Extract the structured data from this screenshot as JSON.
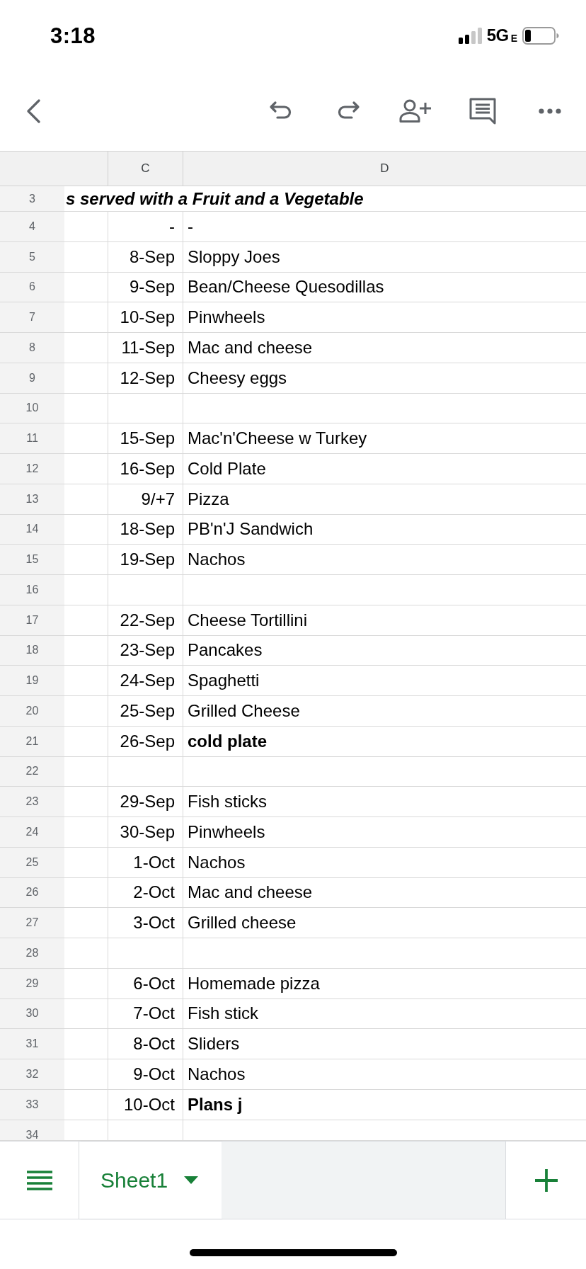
{
  "status_bar": {
    "time": "3:18",
    "network": "5G",
    "network_suffix": "E"
  },
  "sheet": {
    "columns": [
      {
        "label": "C"
      },
      {
        "label": "D"
      }
    ],
    "rows": [
      {
        "number": "3",
        "kind": "title",
        "text": "s served with a Fruit and a Vegetable"
      },
      {
        "number": "4",
        "kind": "data",
        "date": "-",
        "meal": "-",
        "bold": false
      },
      {
        "number": "5",
        "kind": "data",
        "date": "8-Sep",
        "meal": "Sloppy Joes",
        "bold": false
      },
      {
        "number": "6",
        "kind": "data",
        "date": "9-Sep",
        "meal": "Bean/Cheese Quesodillas",
        "bold": false
      },
      {
        "number": "7",
        "kind": "data",
        "date": "10-Sep",
        "meal": "Pinwheels",
        "bold": false
      },
      {
        "number": "8",
        "kind": "data",
        "date": "11-Sep",
        "meal": "Mac and cheese",
        "bold": false
      },
      {
        "number": "9",
        "kind": "data",
        "date": "12-Sep",
        "meal": "Cheesy eggs",
        "bold": false
      },
      {
        "number": "10",
        "kind": "data"
      },
      {
        "number": "11",
        "kind": "data",
        "date": "15-Sep",
        "meal": "Mac'n'Cheese w Turkey",
        "bold": false
      },
      {
        "number": "12",
        "kind": "data",
        "date": "16-Sep",
        "meal": "Cold Plate",
        "bold": false
      },
      {
        "number": "13",
        "kind": "data",
        "date": "9/+7",
        "meal": "Pizza",
        "bold": false
      },
      {
        "number": "14",
        "kind": "data",
        "date": "18-Sep",
        "meal": "PB'n'J Sandwich",
        "bold": false
      },
      {
        "number": "15",
        "kind": "data",
        "date": "19-Sep",
        "meal": "Nachos",
        "bold": false
      },
      {
        "number": "16",
        "kind": "data"
      },
      {
        "number": "17",
        "kind": "data",
        "date": "22-Sep",
        "meal": "Cheese Tortillini",
        "bold": false
      },
      {
        "number": "18",
        "kind": "data",
        "date": "23-Sep",
        "meal": "Pancakes",
        "bold": false
      },
      {
        "number": "19",
        "kind": "data",
        "date": "24-Sep",
        "meal": "Spaghetti",
        "bold": false
      },
      {
        "number": "20",
        "kind": "data",
        "date": "25-Sep",
        "meal": "Grilled Cheese",
        "bold": false
      },
      {
        "number": "21",
        "kind": "data",
        "date": "26-Sep",
        "meal": "cold plate",
        "bold": true
      },
      {
        "number": "22",
        "kind": "data"
      },
      {
        "number": "23",
        "kind": "data",
        "date": "29-Sep",
        "meal": "Fish sticks",
        "bold": false
      },
      {
        "number": "24",
        "kind": "data",
        "date": "30-Sep",
        "meal": "Pinwheels",
        "bold": false
      },
      {
        "number": "25",
        "kind": "data",
        "date": "1-Oct",
        "meal": "Nachos",
        "bold": false
      },
      {
        "number": "26",
        "kind": "data",
        "date": "2-Oct",
        "meal": "Mac and cheese",
        "bold": false
      },
      {
        "number": "27",
        "kind": "data",
        "date": "3-Oct",
        "meal": "Grilled cheese",
        "bold": false
      },
      {
        "number": "28",
        "kind": "data"
      },
      {
        "number": "29",
        "kind": "data",
        "date": "6-Oct",
        "meal": "Homemade pizza",
        "bold": false
      },
      {
        "number": "30",
        "kind": "data",
        "date": "7-Oct",
        "meal": "Fish stick",
        "bold": false
      },
      {
        "number": "31",
        "kind": "data",
        "date": "8-Oct",
        "meal": "Sliders",
        "bold": false
      },
      {
        "number": "32",
        "kind": "data",
        "date": "9-Oct",
        "meal": "Nachos",
        "bold": false
      },
      {
        "number": "33",
        "kind": "data",
        "date": "10-Oct",
        "meal": "Plans j",
        "bold": true
      },
      {
        "number": "34",
        "kind": "data"
      }
    ]
  },
  "sheet_tabs": [
    {
      "label": "Sheet1",
      "selected": true
    }
  ]
}
